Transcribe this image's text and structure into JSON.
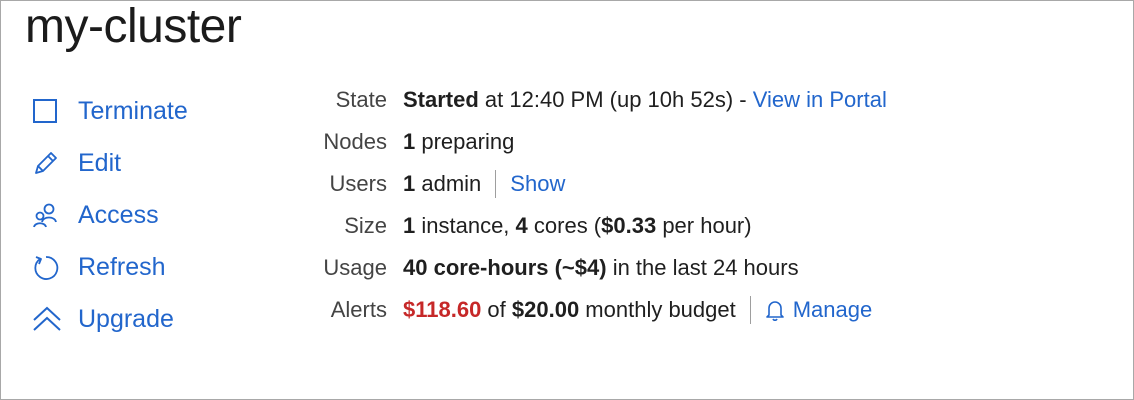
{
  "header": {
    "title": "my-cluster"
  },
  "actions": {
    "terminate": "Terminate",
    "edit": "Edit",
    "access": "Access",
    "refresh": "Refresh",
    "upgrade": "Upgrade"
  },
  "state": {
    "key": "State",
    "status": "Started",
    "detail": " at 12:40 PM (up 10h 52s) - ",
    "link": "View in Portal"
  },
  "nodes": {
    "key": "Nodes",
    "count": "1",
    "text": " preparing"
  },
  "users": {
    "key": "Users",
    "count": "1",
    "text": " admin",
    "link": "Show"
  },
  "size": {
    "key": "Size",
    "instances": "1",
    "instances_text": " instance, ",
    "cores": "4",
    "cores_text": " cores (",
    "price": "$0.33",
    "price_text": " per hour)"
  },
  "usage": {
    "key": "Usage",
    "amount": "40 core-hours (~$4)",
    "text": " in the last 24 hours"
  },
  "alerts": {
    "key": "Alerts",
    "spent": "$118.60",
    "of_text": " of ",
    "budget": "$20.00",
    "budget_text": " monthly budget",
    "link": "Manage"
  },
  "colors": {
    "accent": "#2266cc",
    "alert": "#c62828"
  },
  "icons": [
    "square-icon",
    "pencil-icon",
    "users-icon",
    "refresh-icon",
    "chevrons-up-icon",
    "bell-icon"
  ]
}
